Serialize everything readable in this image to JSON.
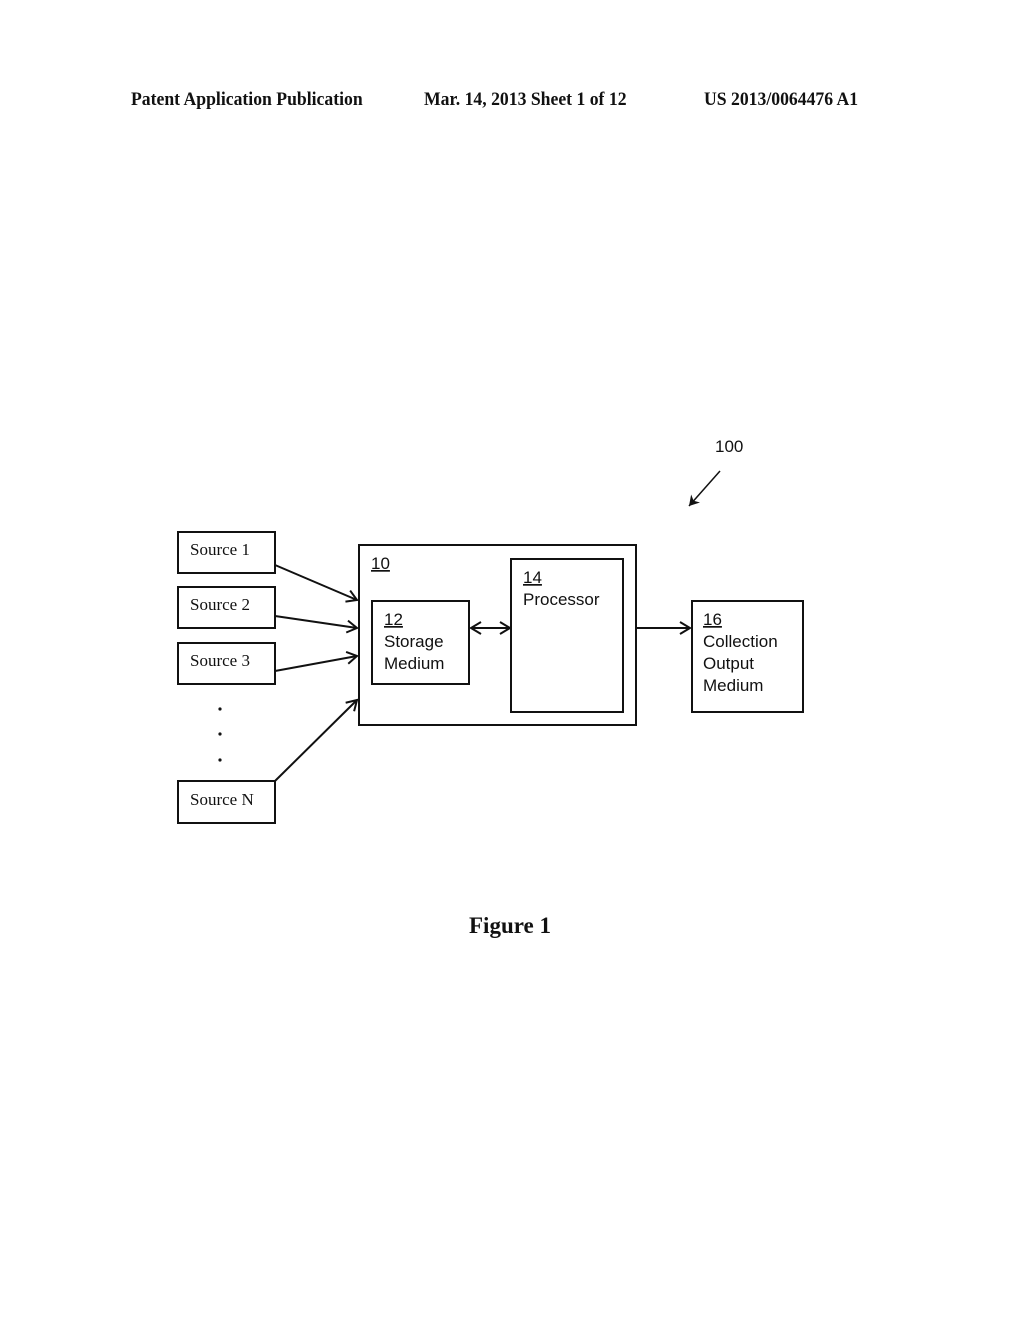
{
  "header": {
    "publication_label": "Patent Application Publication",
    "date_sheet": "Mar. 14, 2013  Sheet 1 of 12",
    "publication_number": "US 2013/0064476 A1"
  },
  "diagram": {
    "system_ref": "100",
    "sources": [
      {
        "label": "Source 1"
      },
      {
        "label": "Source 2"
      },
      {
        "label": "Source 3"
      },
      {
        "label": "Source N"
      }
    ],
    "ellipsis": "·",
    "main_unit": {
      "ref": "10"
    },
    "storage": {
      "ref": "12",
      "line1": "Storage",
      "line2": "Medium"
    },
    "processor": {
      "ref": "14",
      "line1": "Processor"
    },
    "output": {
      "ref": "16",
      "line1": "Collection",
      "line2": "Output",
      "line3": "Medium"
    }
  },
  "caption": "Figure 1"
}
